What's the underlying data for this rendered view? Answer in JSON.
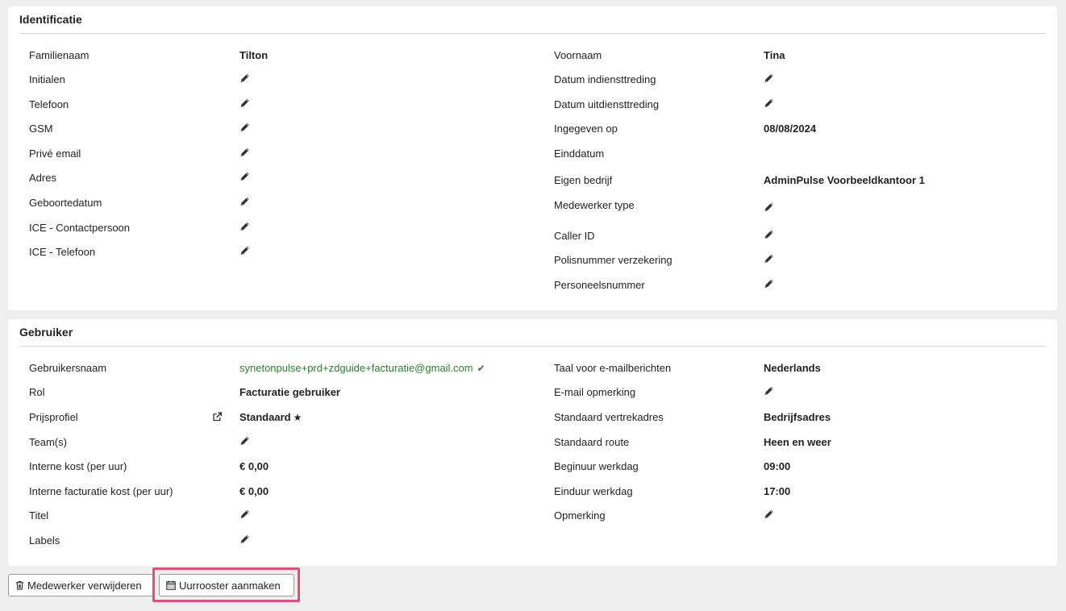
{
  "identificatie": {
    "title": "Identificatie",
    "left": [
      {
        "label": "Familienaam",
        "value": "Tilton"
      },
      {
        "label": "Initialen",
        "value": null
      },
      {
        "label": "Telefoon",
        "value": null
      },
      {
        "label": "GSM",
        "value": null
      },
      {
        "label": "Privé email",
        "value": null
      },
      {
        "label": "Adres",
        "value": null
      },
      {
        "label": "Geboortedatum",
        "value": null
      },
      {
        "label": "ICE - Contactpersoon",
        "value": null
      },
      {
        "label": "ICE - Telefoon",
        "value": null
      }
    ],
    "right": [
      {
        "label": "Voornaam",
        "value": "Tina"
      },
      {
        "label": "Datum indiensttreding",
        "value": null
      },
      {
        "label": "Datum uitdiensttreding",
        "value": null
      },
      {
        "label": "Ingegeven op",
        "value": "08/08/2024"
      },
      {
        "label": "Einddatum",
        "value": ""
      },
      {
        "label": "Eigen bedrijf",
        "value": "AdminPulse Voorbeeldkantoor 1"
      },
      {
        "label": "Medewerker type",
        "value": null
      },
      {
        "label": "Caller ID",
        "value": null
      },
      {
        "label": "Polisnummer verzekering",
        "value": null
      },
      {
        "label": "Personeelsnummer",
        "value": null
      }
    ]
  },
  "gebruiker": {
    "title": "Gebruiker",
    "left": [
      {
        "label": "Gebruikersnaam",
        "value": "synetonpulse+prd+zdguide+facturatie@gmail.com"
      },
      {
        "label": "Rol",
        "value": "Facturatie gebruiker"
      },
      {
        "label": "Prijsprofiel",
        "value": "Standaard"
      },
      {
        "label": "Team(s)",
        "value": null
      },
      {
        "label": "Interne kost (per uur)",
        "value": "€ 0,00"
      },
      {
        "label": "Interne facturatie kost (per uur)",
        "value": "€ 0,00"
      },
      {
        "label": "Titel",
        "value": null
      },
      {
        "label": "Labels",
        "value": null
      }
    ],
    "right": [
      {
        "label": "Taal voor e-mailberichten",
        "value": "Nederlands"
      },
      {
        "label": "E-mail opmerking",
        "value": null
      },
      {
        "label": "Standaard vertrekadres",
        "value": "Bedrijfsadres"
      },
      {
        "label": "Standaard route",
        "value": "Heen en weer"
      },
      {
        "label": "Beginuur werkdag",
        "value": "09:00"
      },
      {
        "label": "Einduur werkdag",
        "value": "17:00"
      },
      {
        "label": "Opmerking",
        "value": null
      }
    ]
  },
  "actions": {
    "delete_label": "Medewerker verwijderen",
    "delete_icon": "trash-icon",
    "schedule_label": "Uurrooster aanmaken",
    "schedule_icon": "calendar-icon"
  },
  "colors": {
    "verified_green": "#2e7d32",
    "highlight": "#e0507a",
    "background": "#efefef"
  }
}
